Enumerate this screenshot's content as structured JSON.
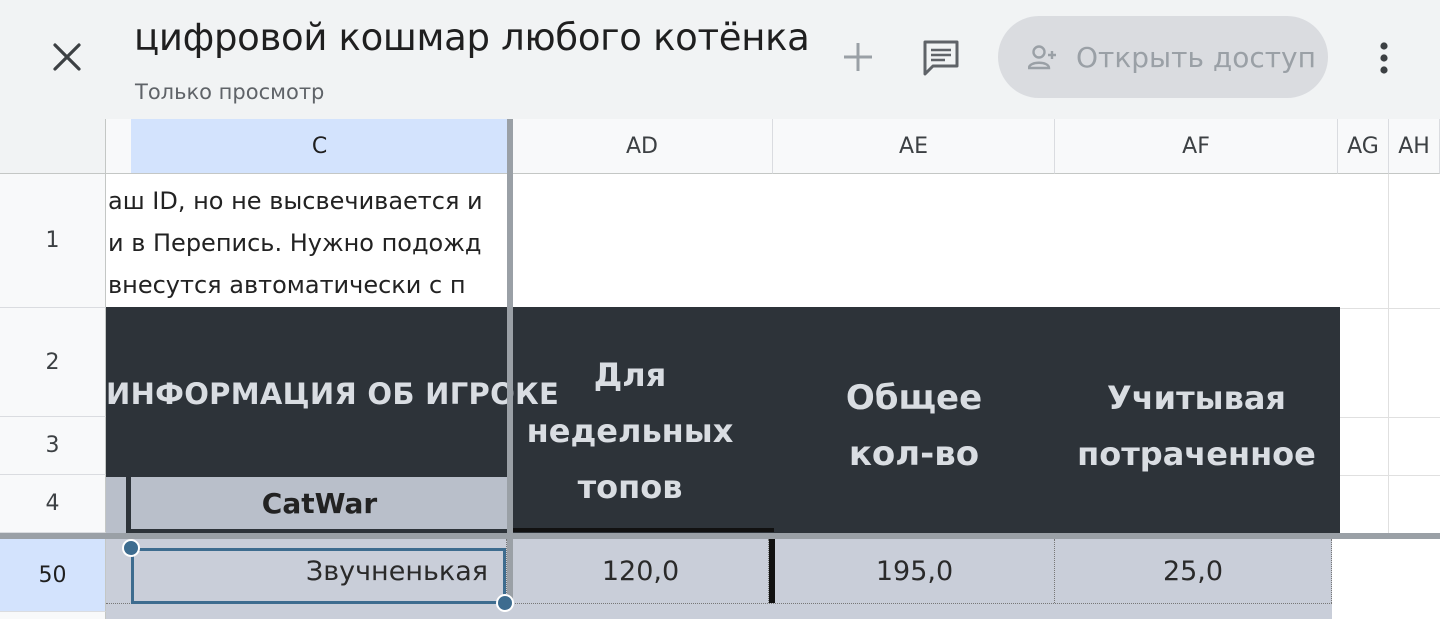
{
  "appbar": {
    "title": "цифровой кошмар любого котёнка",
    "subtitle": "Только просмотр",
    "share_label": "Открыть доступ"
  },
  "icons": {
    "close": "close-icon",
    "add": "plus-icon",
    "comment": "comment-icon",
    "share": "person-add-icon",
    "more": "more-vert-icon"
  },
  "columns": {
    "c": "C",
    "ad": "AD",
    "ae": "AE",
    "af": "AF",
    "ag": "AG",
    "ah": "AH"
  },
  "rows": {
    "r1": "1",
    "r2": "2",
    "r3": "3",
    "r4": "4",
    "r50": "50"
  },
  "cells": {
    "c1_line1": "аш ID, но не высвечивается и",
    "c1_line2": "и в Перепись. Нужно подожд",
    "c1_line3": " внесутся автоматически с п",
    "c2": "ИНФОРМАЦИЯ ОБ ИГРОКЕ",
    "c4": "CatWar",
    "ad_header_l1": "Для",
    "ad_header_l2": "недельных",
    "ad_header_l3": "топов",
    "ae_header_l1": "Общее",
    "ae_header_l2": "кол-во",
    "af_header_l1": "Учитывая",
    "af_header_l2": "потраченное",
    "c50": "Звучненькая",
    "ad50": "120,0",
    "ae50": "195,0",
    "af50": "25,0"
  },
  "colors": {
    "appbar_bg": "#f1f3f4",
    "header_dark": "#2d3339",
    "selected_col": "#d3e3fd",
    "selection_border": "#3d6c8f"
  }
}
